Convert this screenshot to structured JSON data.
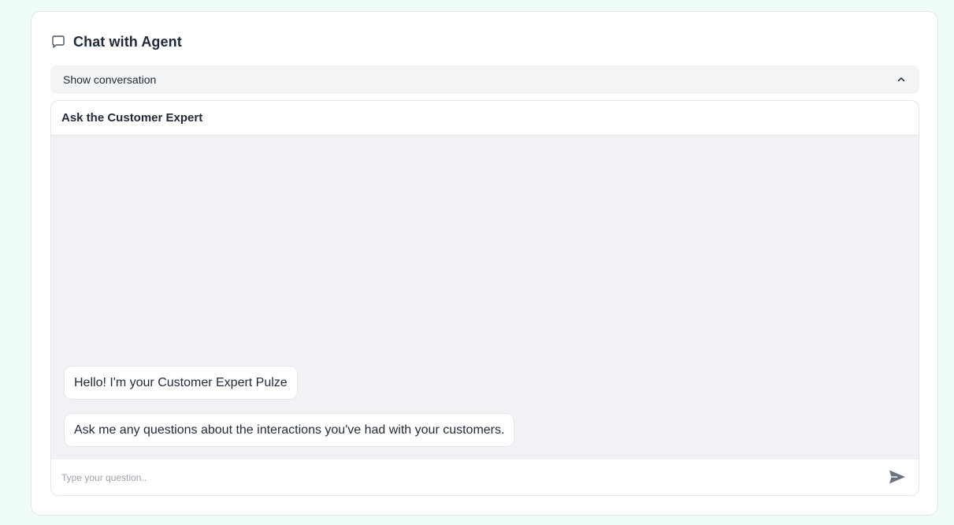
{
  "panel": {
    "title": "Chat with Agent",
    "icon": "chat-bubble-icon"
  },
  "toggle": {
    "label": "Show conversation",
    "icon": "chevron-up-icon"
  },
  "chat": {
    "title": "Ask the Customer Expert",
    "messages": [
      "Hello! I'm your Customer Expert Pulze",
      "Ask me any questions about the interactions you've had with your customers."
    ],
    "input_placeholder": "Type your question..",
    "send_icon": "send-icon"
  },
  "colors": {
    "page_background": "#effcf9",
    "message_area": "#f1f2f5",
    "toggle_background": "#f3f4f6"
  }
}
